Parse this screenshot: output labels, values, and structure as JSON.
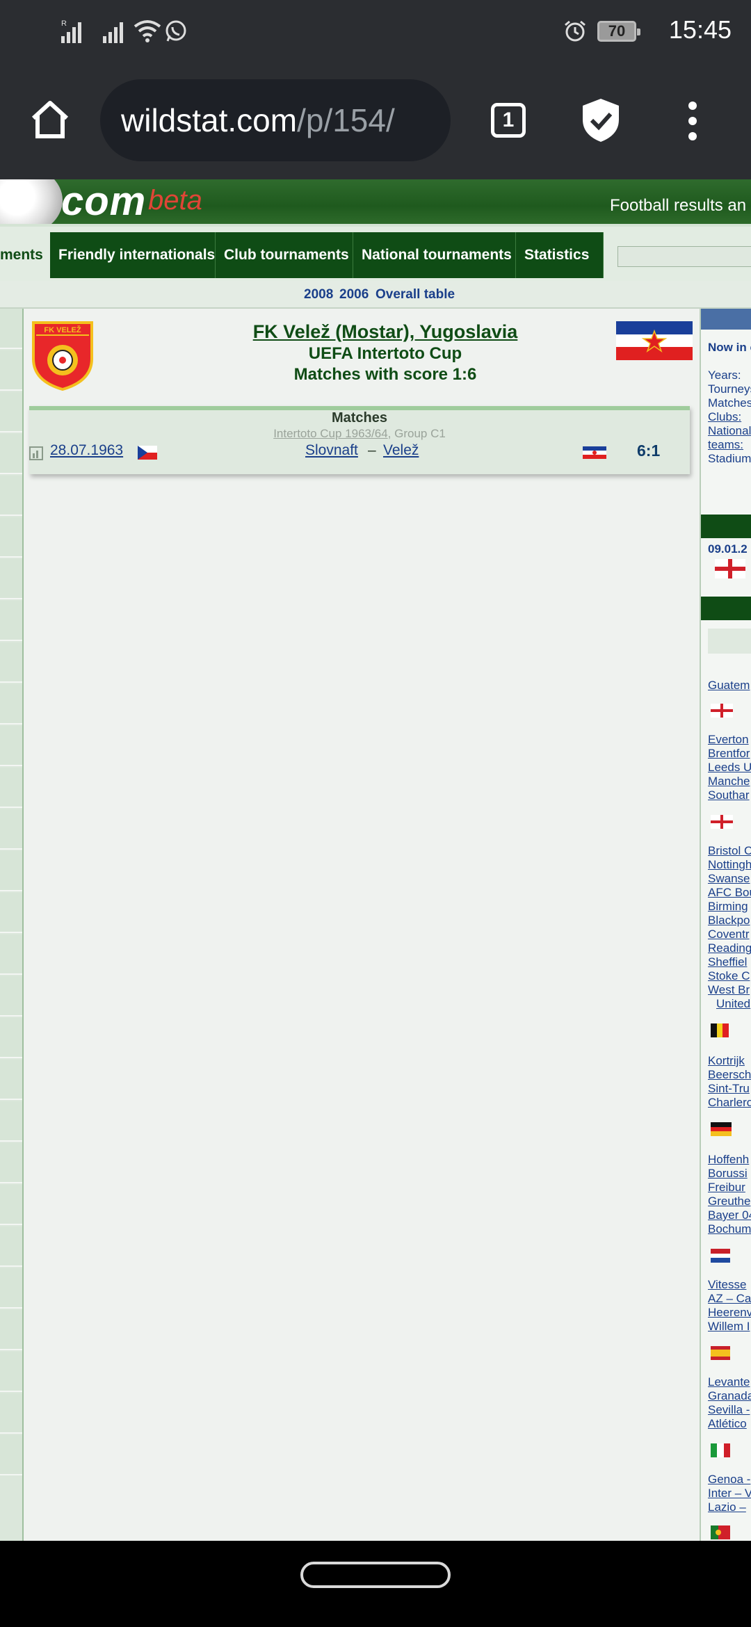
{
  "status_bar": {
    "time": "15:45",
    "battery": "70",
    "signal_label": "R",
    "icons": [
      "signal-icon",
      "signal-icon-2",
      "wifi-icon",
      "whatsapp-icon",
      "alarm-icon",
      "battery-icon"
    ]
  },
  "browser": {
    "url_host": "wildstat.com",
    "url_path": "/p/154/",
    "tab_count": "1",
    "icons": [
      "home-icon",
      "shield-check-icon",
      "more-vert-icon"
    ]
  },
  "site": {
    "logo_com": "com",
    "logo_beta": "beta",
    "tagline": "Football results an"
  },
  "nav": {
    "items": [
      {
        "label": "ments",
        "active": true
      },
      {
        "label": "Friendly internationals",
        "active": false
      },
      {
        "label": "Club tournaments",
        "active": false
      },
      {
        "label": "National tournaments",
        "active": false
      },
      {
        "label": "Statistics",
        "active": false
      }
    ]
  },
  "subnav": {
    "links": [
      "2008",
      "2006",
      "Overall table"
    ]
  },
  "club": {
    "badge_text": "FK VELEŽ",
    "name": "FK Velež (Mostar), Yugoslavia",
    "tournament": "UEFA Intertoto Cup",
    "score_line": "Matches with score 1:6"
  },
  "matches": {
    "title": "Matches",
    "group_tournament": "Intertoto Cup 1963/64",
    "group_suffix": ", Group C1",
    "rows": [
      {
        "date": "28.07.1963",
        "home": "Slovnaft",
        "dash": "–",
        "away": "Velež",
        "score": "6:1"
      }
    ]
  },
  "right_col": {
    "now_in": "Now in c",
    "stats": [
      "Years:",
      "Tourneys",
      "Matches",
      "Clubs:",
      "National",
      "teams:",
      "Stadium"
    ],
    "date": "09.01.2",
    "items": [
      "Guatem",
      "Everton",
      "Brentfor",
      "Leeds U",
      "Manche",
      "Southar",
      "Bristol C",
      "Nottingh",
      "Swanse",
      "AFC Bou",
      "Birming",
      "Blackpo",
      "Coventr",
      "Reading",
      "Sheffiel",
      "Stoke C",
      "West Br",
      "United",
      "Kortrijk",
      "Beersch",
      "Sint-Tru",
      "Charlero",
      "Hoffenh",
      "Borussi",
      "Freibur",
      "Greuthe",
      "Bayer 04",
      "Bochum",
      "Vitesse",
      "AZ – Ca",
      "Heerenv",
      "Willem I",
      "Levante",
      "Granada",
      "Sevilla -",
      "Atlético",
      "Genoa -",
      "Inter – V",
      "Lazio –"
    ]
  }
}
